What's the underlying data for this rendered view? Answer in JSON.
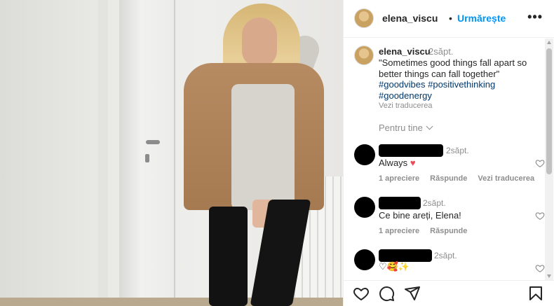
{
  "post": {
    "username": "elena_viscu",
    "separator": "•",
    "follow_label": "Urmărește",
    "more_icon": "more-horizontal-icon",
    "caption": {
      "username": "elena_viscu",
      "time": "2săpt.",
      "text": "\"Sometimes good things fall apart so better things can fall together\"",
      "hashtags_line1": "#goodvibes #positivethinking",
      "hashtags_line2": "#goodenergy",
      "translate": "Vezi traducerea"
    },
    "for_you": "Pentru tine"
  },
  "comments": [
    {
      "time": "2săpt.",
      "text": "Always",
      "emoji": "♥",
      "likes": "1 apreciere",
      "reply": "Răspunde",
      "translate": "Vezi traducerea"
    },
    {
      "time": "2săpt.",
      "text": "Ce bine areți, Elena!",
      "likes": "1 apreciere",
      "reply": "Răspunde"
    },
    {
      "time": "2săpt.",
      "text": "♡🥰✨"
    }
  ],
  "actions": {
    "like_icon": "heart-icon",
    "comment_icon": "comment-icon",
    "share_icon": "send-icon",
    "save_icon": "bookmark-icon"
  },
  "colors": {
    "link_blue": "#0095f6",
    "hashtag": "#00376b",
    "muted": "#8e8e8e",
    "heart": "#ed4956"
  }
}
